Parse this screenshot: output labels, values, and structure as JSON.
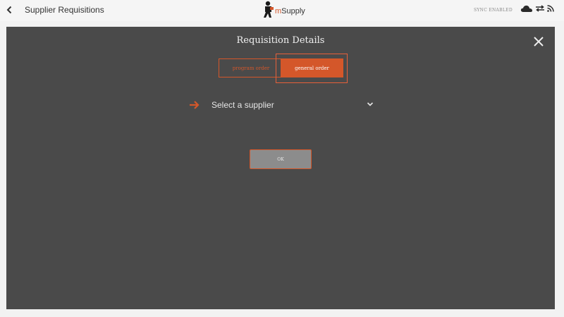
{
  "header": {
    "title": "Supplier Requisitions",
    "logo_prefix": "m",
    "logo_text": "Supply",
    "sync_status": "SYNC ENABLED",
    "icons": [
      "back-chevron-icon",
      "cloud-icon",
      "sync-arrows-icon",
      "rss-icon"
    ]
  },
  "modal": {
    "title": "Requisition Details",
    "tabs": [
      {
        "label": "program order",
        "selected": false
      },
      {
        "label": "general order",
        "selected": true
      }
    ],
    "supplier_select": {
      "label": "Select a supplier"
    },
    "ok_label": "OK",
    "close_icon": "close-icon",
    "arrow_icon": "right-arrow-icon",
    "chevron_icon": "chevron-down-icon"
  },
  "colors": {
    "accent": "#d4572a",
    "modal_bg": "#4a4a4a",
    "ok_bg": "#8c8c8c",
    "header_bg": "#f5f5f5"
  }
}
